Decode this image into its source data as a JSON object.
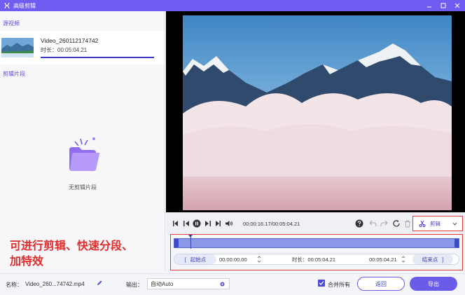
{
  "window": {
    "title": "高级剪辑"
  },
  "sidebar": {
    "source_section_label": "源视频",
    "source": {
      "name": "Video_260112174742",
      "duration": "时长：00:05:04.21"
    },
    "clips_section_label": "剪辑片段",
    "empty_text": "无剪辑片段"
  },
  "player": {
    "time_readout": "00:00:16.17/00:05:04.21",
    "edit_mode_label": "剪辑"
  },
  "timeline": {
    "start_button": "起始点",
    "start_time": "00:00:00.00",
    "duration": "时长：00:05:04.21",
    "end_time": "00:05:04.21",
    "end_button": "结束点"
  },
  "overlay": {
    "line1": "可进行剪辑、快速分段、",
    "line2": "加特效"
  },
  "bottom": {
    "name_label": "名称：",
    "name_value": "Video_260...74742.mp4",
    "output_label": "输出：",
    "output_value": "自动Auto",
    "merge_label": "合并所有",
    "back_button": "返回",
    "export_button": "导出"
  },
  "colors": {
    "accent": "#6f5cf1",
    "highlight_red": "#e23b3b"
  }
}
